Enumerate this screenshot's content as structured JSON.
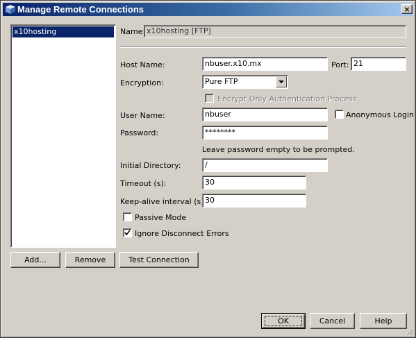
{
  "window": {
    "title": "Manage Remote Connections",
    "close_glyph": "×"
  },
  "connections": {
    "items": [
      {
        "label": "x10hosting",
        "selected": true
      }
    ]
  },
  "form": {
    "name_label": "Name:",
    "name_value": "x10hosting [FTP]",
    "host_label": "Host Name:",
    "host_value": "nbuser.x10.mx",
    "port_label": "Port:",
    "port_value": "21",
    "encryption_label": "Encryption:",
    "encryption_value": "Pure FTP",
    "encrypt_auth_label": "Encrypt Only Authentication Process",
    "encrypt_auth_checked": false,
    "user_label": "User Name:",
    "user_value": "nbuser",
    "anonymous_label": "Anonymous Login",
    "anonymous_checked": false,
    "password_label": "Password:",
    "password_value": "********",
    "password_hint": "Leave password empty to be prompted.",
    "initial_dir_label": "Initial Directory:",
    "initial_dir_value": "/",
    "timeout_label": "Timeout (s):",
    "timeout_value": "30",
    "keepalive_label": "Keep-alive interval (s):",
    "keepalive_value": "30",
    "passive_label": "Passive Mode",
    "passive_checked": false,
    "ignore_label": "Ignore Disconnect Errors",
    "ignore_checked": true
  },
  "buttons": {
    "add": "Add...",
    "remove": "Remove",
    "test": "Test Connection",
    "ok": "OK",
    "cancel": "Cancel",
    "help": "Help"
  },
  "colors": {
    "title_gradient_start": "#0a246a",
    "title_gradient_end": "#a6caf0",
    "selection": "#0a246a",
    "face": "#d4d0c8"
  }
}
